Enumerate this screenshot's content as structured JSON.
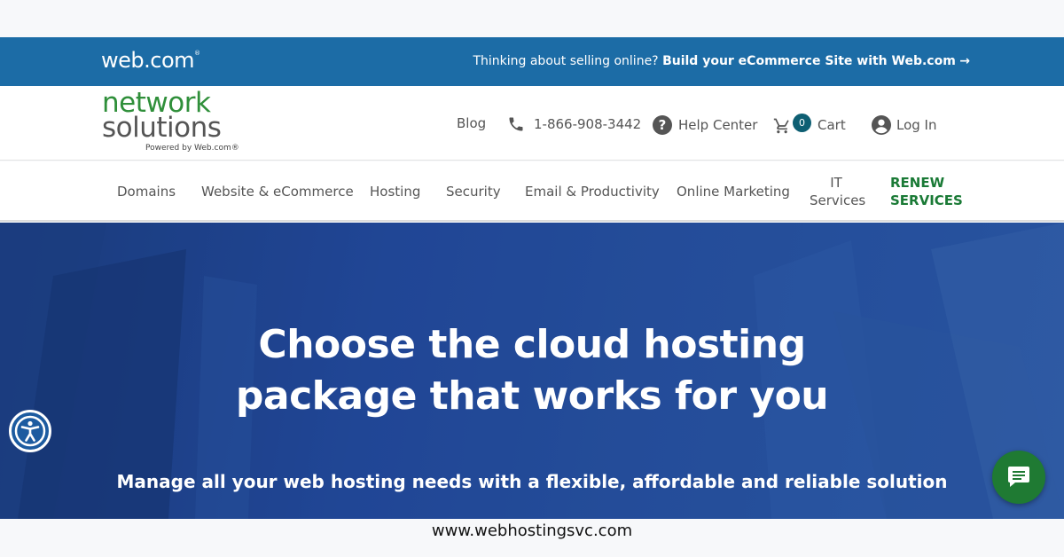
{
  "promo_bar": {
    "logo_text": "web.com",
    "logo_mark": "®",
    "message_prefix": "Thinking about selling online? ",
    "message_link": "Build your eCommerce Site with Web.com",
    "arrow": "→"
  },
  "header": {
    "logo_line1": "network",
    "logo_line2": "solutions",
    "logo_powered": "Powered by Web.com®",
    "blog": "Blog",
    "phone": "1-866-908-3442",
    "help": "Help Center",
    "cart_count": "0",
    "cart": "Cart",
    "login": "Log In"
  },
  "nav": {
    "items": [
      "Domains",
      "Website & eCommerce",
      "Hosting",
      "Security",
      "Email & Productivity",
      "Online Marketing"
    ],
    "it_line1": "IT",
    "it_line2": "Services",
    "renew_line1": "RENEW",
    "renew_line2": "SERVICES"
  },
  "hero": {
    "title_line1": "Choose the cloud hosting",
    "title_line2": "package that works for you",
    "subtitle": "Manage all your web hosting needs with a flexible, affordable and reliable solution"
  },
  "footer": {
    "url": "www.webhostingsvc.com"
  },
  "icons": [
    "phone-icon",
    "help-icon",
    "cart-icon",
    "user-icon",
    "accessibility-icon",
    "chat-icon"
  ],
  "colors": {
    "promo_bg": "#1c6ca6",
    "brand_green": "#2f8f3a",
    "renew_green": "#1a7a36",
    "hero_blue": "#22489a",
    "cart_badge": "#0e5f73",
    "chat_green": "#1f7a33"
  }
}
